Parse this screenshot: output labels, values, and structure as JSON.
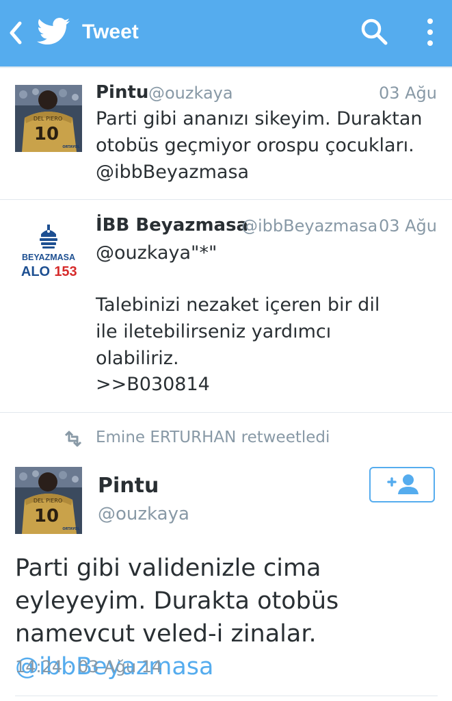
{
  "header": {
    "title": "Tweet",
    "back_icon": "back-chevron-icon",
    "logo_icon": "twitter-bird-icon",
    "search_icon": "search-icon",
    "overflow_icon": "overflow-menu-icon",
    "bar_color": "#55acee"
  },
  "tweets": [
    {
      "name": "Pintu",
      "handle": "@ouzkaya",
      "date": "03 Ağu",
      "text": "Parti gibi ananızı sikeyim. Duraktan otobüs geçmiyor orospu çocukları. @ibbBeyazmasa",
      "avatar": {
        "jersey_name": "DEL PIERO",
        "number": "10",
        "badge": "ORTAYOL"
      }
    },
    {
      "name": "İBB Beyazmasa",
      "handle": "@ibbBeyazmasa",
      "date": "03 Ağu",
      "text_line1": "@ouzkaya\"*\"",
      "text_line2": "Talebinizi nezaket içeren bir dil ile iletebilirseniz yardımcı olabiliriz.",
      "text_line3": ">>B030814",
      "avatar": {
        "logo_top": "BEYAZMASA",
        "logo_alo": "ALO",
        "logo_num": "153"
      }
    }
  ],
  "retweet": {
    "label": "Emine ERTURHAN retweetledi",
    "icon": "retweet-icon"
  },
  "main_tweet": {
    "name": "Pintu",
    "handle": "@ouzkaya",
    "text_plain": "Parti gibi validenizle cima eyleyeyim. Durakta otobüs namevcut veled-i zinalar.",
    "mention": "@ibbBeyazmasa",
    "timestamp": "14:24 · 03 Ağu 14",
    "follow_icon": "follow-add-user-icon",
    "avatar": {
      "jersey_name": "DEL PIERO",
      "number": "10",
      "badge": "ORTAYOL"
    }
  }
}
